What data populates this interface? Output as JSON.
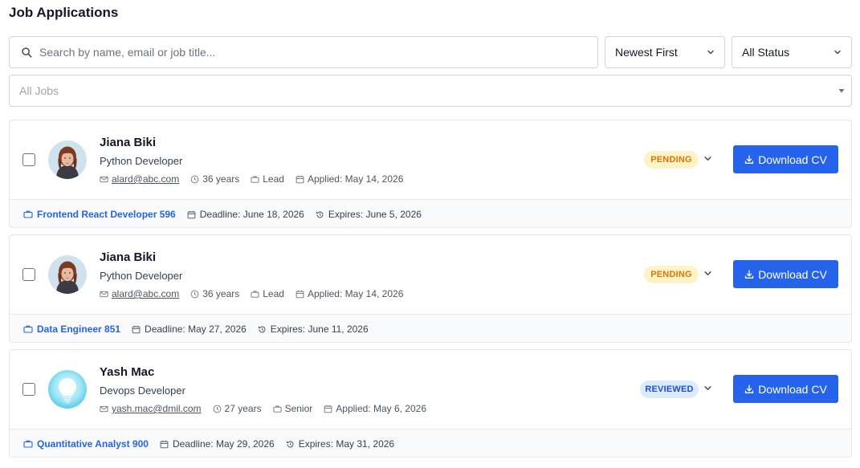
{
  "page": {
    "title": "Job Applications"
  },
  "filters": {
    "search_placeholder": "Search by name, email or job title...",
    "sort_label": "Newest First",
    "status_label": "All Status",
    "jobs_label": "All Jobs"
  },
  "applications": [
    {
      "name": "Jiana Biki",
      "title": "Python Developer",
      "email": "alard@abc.com",
      "age": "36 years",
      "level": "Lead",
      "applied": "Applied: May 14, 2026",
      "status": "PENDING",
      "download_label": "Download CV",
      "job": "Frontend React Developer 596",
      "deadline": "Deadline: June 18, 2026",
      "expires": "Expires: June 5, 2026"
    },
    {
      "name": "Jiana Biki",
      "title": "Python Developer",
      "email": "alard@abc.com",
      "age": "36 years",
      "level": "Lead",
      "applied": "Applied: May 14, 2026",
      "status": "PENDING",
      "download_label": "Download CV",
      "job": "Data Engineer 851",
      "deadline": "Deadline: May 27, 2026",
      "expires": "Expires: June 11, 2026"
    },
    {
      "name": "Yash Mac",
      "title": "Devops Developer",
      "email": "yash.mac@dmil.com",
      "age": "27 years",
      "level": "Senior",
      "applied": "Applied: May 6, 2026",
      "status": "REVIEWED",
      "download_label": "Download CV",
      "job": "Quantitative Analyst 900",
      "deadline": "Deadline: May 29, 2026",
      "expires": "Expires: May 31, 2026"
    }
  ],
  "colors": {
    "primary": "#2563eb",
    "pending_bg": "#fef3c7",
    "pending_text": "#d97706",
    "reviewed_bg": "#dbeafe",
    "reviewed_text": "#1d4ed8"
  },
  "icons": {
    "search": "search-icon",
    "chevron": "chevron-down-icon",
    "mail": "mail-icon",
    "clock": "clock-icon",
    "briefcase": "briefcase-icon",
    "calendar": "calendar-icon",
    "history": "history-icon",
    "download": "download-icon"
  }
}
